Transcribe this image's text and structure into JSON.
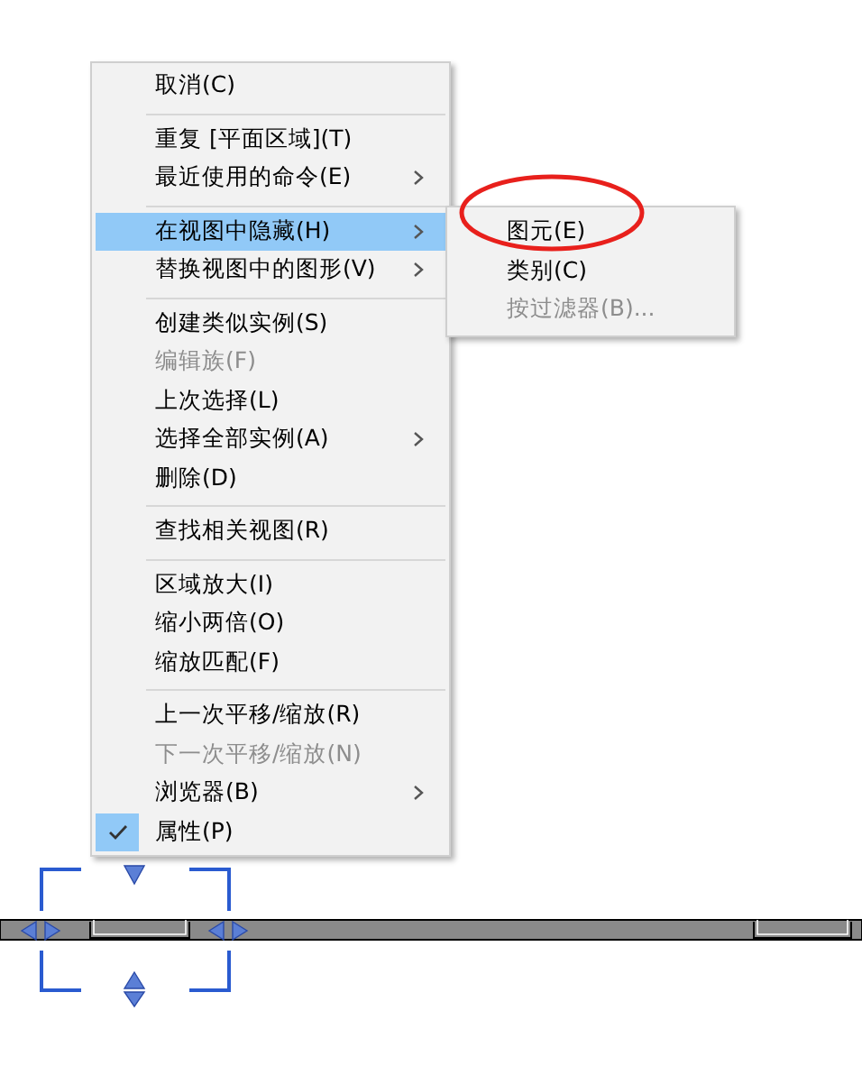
{
  "context_menu": {
    "items": [
      {
        "kind": "item",
        "label": "取消(C)",
        "selected": false,
        "disabled": false,
        "checked": false,
        "submenu": false
      },
      {
        "kind": "separator"
      },
      {
        "kind": "item",
        "label": "重复 [平面区域](T)",
        "selected": false,
        "disabled": false,
        "checked": false,
        "submenu": false
      },
      {
        "kind": "item",
        "label": "最近使用的命令(E)",
        "selected": false,
        "disabled": false,
        "checked": false,
        "submenu": true
      },
      {
        "kind": "separator"
      },
      {
        "kind": "item",
        "label": "在视图中隐藏(H)",
        "selected": true,
        "disabled": false,
        "checked": false,
        "submenu": true
      },
      {
        "kind": "item",
        "label": "替换视图中的图形(V)",
        "selected": false,
        "disabled": false,
        "checked": false,
        "submenu": true
      },
      {
        "kind": "separator"
      },
      {
        "kind": "item",
        "label": "创建类似实例(S)",
        "selected": false,
        "disabled": false,
        "checked": false,
        "submenu": false
      },
      {
        "kind": "item",
        "label": "编辑族(F)",
        "selected": false,
        "disabled": true,
        "checked": false,
        "submenu": false
      },
      {
        "kind": "item",
        "label": "上次选择(L)",
        "selected": false,
        "disabled": false,
        "checked": false,
        "submenu": false
      },
      {
        "kind": "item",
        "label": "选择全部实例(A)",
        "selected": false,
        "disabled": false,
        "checked": false,
        "submenu": true
      },
      {
        "kind": "item",
        "label": "删除(D)",
        "selected": false,
        "disabled": false,
        "checked": false,
        "submenu": false
      },
      {
        "kind": "separator"
      },
      {
        "kind": "item",
        "label": "查找相关视图(R)",
        "selected": false,
        "disabled": false,
        "checked": false,
        "submenu": false
      },
      {
        "kind": "separator"
      },
      {
        "kind": "item",
        "label": "区域放大(I)",
        "selected": false,
        "disabled": false,
        "checked": false,
        "submenu": false
      },
      {
        "kind": "item",
        "label": "缩小两倍(O)",
        "selected": false,
        "disabled": false,
        "checked": false,
        "submenu": false
      },
      {
        "kind": "item",
        "label": "缩放匹配(F)",
        "selected": false,
        "disabled": false,
        "checked": false,
        "submenu": false
      },
      {
        "kind": "separator"
      },
      {
        "kind": "item",
        "label": "上一次平移/缩放(R)",
        "selected": false,
        "disabled": false,
        "checked": false,
        "submenu": false
      },
      {
        "kind": "item",
        "label": "下一次平移/缩放(N)",
        "selected": false,
        "disabled": true,
        "checked": false,
        "submenu": false
      },
      {
        "kind": "item",
        "label": "浏览器(B)",
        "selected": false,
        "disabled": false,
        "checked": false,
        "submenu": true
      },
      {
        "kind": "item",
        "label": "属性(P)",
        "selected": false,
        "disabled": false,
        "checked": true,
        "submenu": false
      }
    ]
  },
  "submenu": {
    "items": [
      {
        "label": "图元(E)",
        "disabled": false,
        "highlighted": true
      },
      {
        "label": "类别(C)",
        "disabled": false,
        "highlighted": false
      },
      {
        "label": "按过滤器(B)...",
        "disabled": true,
        "highlighted": false
      }
    ]
  }
}
